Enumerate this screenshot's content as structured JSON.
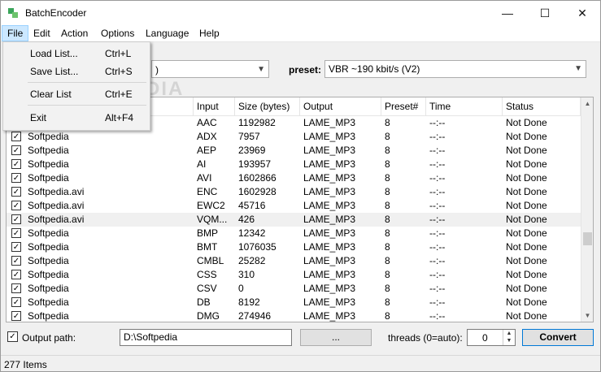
{
  "window": {
    "title": "BatchEncoder",
    "minimize": "—",
    "maximize": "☐",
    "close": "✕"
  },
  "menubar": [
    "File",
    "Edit",
    "Action",
    "Options",
    "Language",
    "Help"
  ],
  "file_menu": [
    {
      "label": "Load List...",
      "shortcut": "Ctrl+L"
    },
    {
      "label": "Save List...",
      "shortcut": "Ctrl+S"
    },
    {
      "label": "Clear List",
      "shortcut": "Ctrl+E"
    },
    {
      "label": "Exit",
      "shortcut": "Alt+F4"
    }
  ],
  "format": {
    "value": ")"
  },
  "preset": {
    "label": "preset:",
    "value": "VBR ~190 kbit/s (V2)"
  },
  "columns": [
    "Input",
    "Size (bytes)",
    "Output",
    "Preset#",
    "Time",
    "Status"
  ],
  "rows": [
    {
      "name": "",
      "input": "AAC",
      "size": "1192982",
      "output": "LAME_MP3",
      "preset": "8",
      "time": "--:--",
      "status": "Not Done"
    },
    {
      "name": "Softpedia",
      "input": "ADX",
      "size": "7957",
      "output": "LAME_MP3",
      "preset": "8",
      "time": "--:--",
      "status": "Not Done"
    },
    {
      "name": "Softpedia",
      "input": "AEP",
      "size": "23969",
      "output": "LAME_MP3",
      "preset": "8",
      "time": "--:--",
      "status": "Not Done"
    },
    {
      "name": "Softpedia",
      "input": "AI",
      "size": "193957",
      "output": "LAME_MP3",
      "preset": "8",
      "time": "--:--",
      "status": "Not Done"
    },
    {
      "name": "Softpedia",
      "input": "AVI",
      "size": "1602866",
      "output": "LAME_MP3",
      "preset": "8",
      "time": "--:--",
      "status": "Not Done"
    },
    {
      "name": "Softpedia.avi",
      "input": "ENC",
      "size": "1602928",
      "output": "LAME_MP3",
      "preset": "8",
      "time": "--:--",
      "status": "Not Done"
    },
    {
      "name": "Softpedia.avi",
      "input": "EWC2",
      "size": "45716",
      "output": "LAME_MP3",
      "preset": "8",
      "time": "--:--",
      "status": "Not Done"
    },
    {
      "name": "Softpedia.avi",
      "input": "VQM...",
      "size": "426",
      "output": "LAME_MP3",
      "preset": "8",
      "time": "--:--",
      "status": "Not Done"
    },
    {
      "name": "Softpedia",
      "input": "BMP",
      "size": "12342",
      "output": "LAME_MP3",
      "preset": "8",
      "time": "--:--",
      "status": "Not Done"
    },
    {
      "name": "Softpedia",
      "input": "BMT",
      "size": "1076035",
      "output": "LAME_MP3",
      "preset": "8",
      "time": "--:--",
      "status": "Not Done"
    },
    {
      "name": "Softpedia",
      "input": "CMBL",
      "size": "25282",
      "output": "LAME_MP3",
      "preset": "8",
      "time": "--:--",
      "status": "Not Done"
    },
    {
      "name": "Softpedia",
      "input": "CSS",
      "size": "310",
      "output": "LAME_MP3",
      "preset": "8",
      "time": "--:--",
      "status": "Not Done"
    },
    {
      "name": "Softpedia",
      "input": "CSV",
      "size": "0",
      "output": "LAME_MP3",
      "preset": "8",
      "time": "--:--",
      "status": "Not Done"
    },
    {
      "name": "Softpedia",
      "input": "DB",
      "size": "8192",
      "output": "LAME_MP3",
      "preset": "8",
      "time": "--:--",
      "status": "Not Done"
    },
    {
      "name": "Softpedia",
      "input": "DMG",
      "size": "274946",
      "output": "LAME_MP3",
      "preset": "8",
      "time": "--:--",
      "status": "Not Done"
    }
  ],
  "bottom": {
    "output_label": "Output path:",
    "output_path": "D:\\Softpedia",
    "browse": "...",
    "threads_label": "threads (0=auto):",
    "threads": "0",
    "convert": "Convert"
  },
  "status": "277 Items",
  "watermark": "SOFTPEDIA",
  "icons": {
    "app": "batchencoder-icon",
    "check": "✓"
  },
  "colors": {
    "menu_active": "#cce8ff",
    "accent": "#0078d7"
  }
}
